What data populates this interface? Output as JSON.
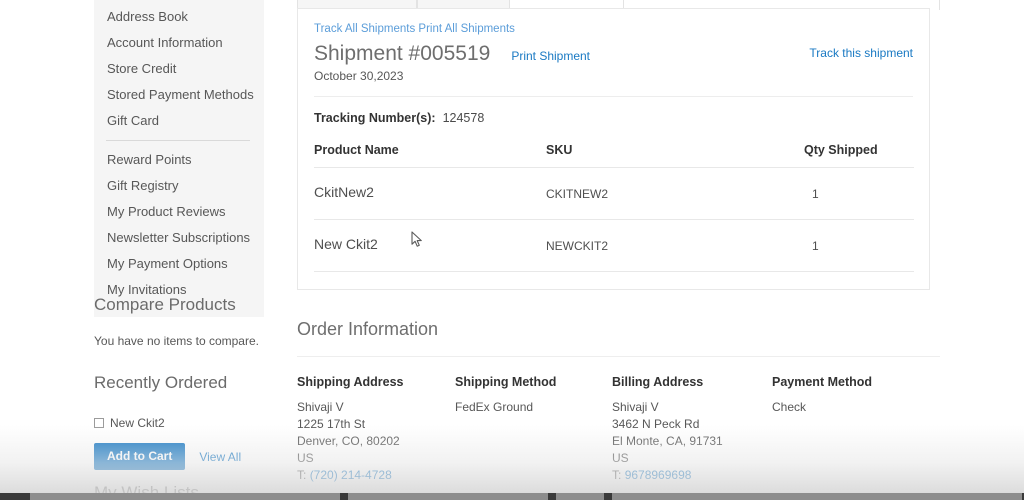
{
  "sidebar": {
    "nav_items_top": [
      {
        "label": "Address Book"
      },
      {
        "label": "Account Information"
      },
      {
        "label": "Store Credit"
      },
      {
        "label": "Stored Payment Methods"
      },
      {
        "label": "Gift Card"
      }
    ],
    "nav_items_bottom": [
      {
        "label": "Reward Points"
      },
      {
        "label": "Gift Registry"
      },
      {
        "label": "My Product Reviews"
      },
      {
        "label": "Newsletter Subscriptions"
      },
      {
        "label": "My Payment Options"
      },
      {
        "label": "My Invitations"
      }
    ],
    "compare": {
      "heading": "Compare Products",
      "empty_text": "You have no items to compare."
    },
    "recently_ordered": {
      "heading": "Recently Ordered",
      "item_label": "New Ckit2",
      "add_to_cart_label": "Add to Cart",
      "view_all_label": "View All"
    },
    "wish_lists": {
      "heading": "My Wish Lists"
    }
  },
  "shipment": {
    "track_all_label": "Track All Shipments",
    "print_all_label": "Print All Shipments",
    "title": "Shipment #005519",
    "print_shipment_label": "Print Shipment",
    "track_this_label": "Track this shipment",
    "date": "October 30,2023",
    "tracking_label": "Tracking Number(s):",
    "tracking_value": "124578",
    "table": {
      "columns": [
        "Product Name",
        "SKU",
        "Qty Shipped"
      ],
      "rows": [
        {
          "name": "CkitNew2",
          "sku": "CKITNEW2",
          "qty": "1"
        },
        {
          "name": "New Ckit2",
          "sku": "NEWCKIT2",
          "qty": "1"
        }
      ]
    }
  },
  "order_information": {
    "title": "Order Information",
    "shipping_address": {
      "heading": "Shipping Address",
      "name": "Shivaji V",
      "street": "1225 17th St",
      "city_state_zip": "Denver, CO, 80202",
      "country": "US",
      "phone_prefix": "T:",
      "phone": "(720) 214-4728"
    },
    "shipping_method": {
      "heading": "Shipping Method",
      "value": "FedEx Ground"
    },
    "billing_address": {
      "heading": "Billing Address",
      "name": "Shivaji V",
      "street": "3462 N Peck Rd",
      "city_state_zip": "El Monte, CA, 91731",
      "country": "US",
      "phone_prefix": "T:",
      "phone": "9678969698"
    },
    "payment_method": {
      "heading": "Payment Method",
      "value": "Check"
    }
  },
  "theme": {
    "link_blue": "#1979c3",
    "muted_link_blue": "#5b9dd9",
    "button_blue": "#1979c3",
    "nav_background": "#f5f5f5",
    "text_gray": "#575757",
    "heading_gray": "#6e6e6e"
  }
}
